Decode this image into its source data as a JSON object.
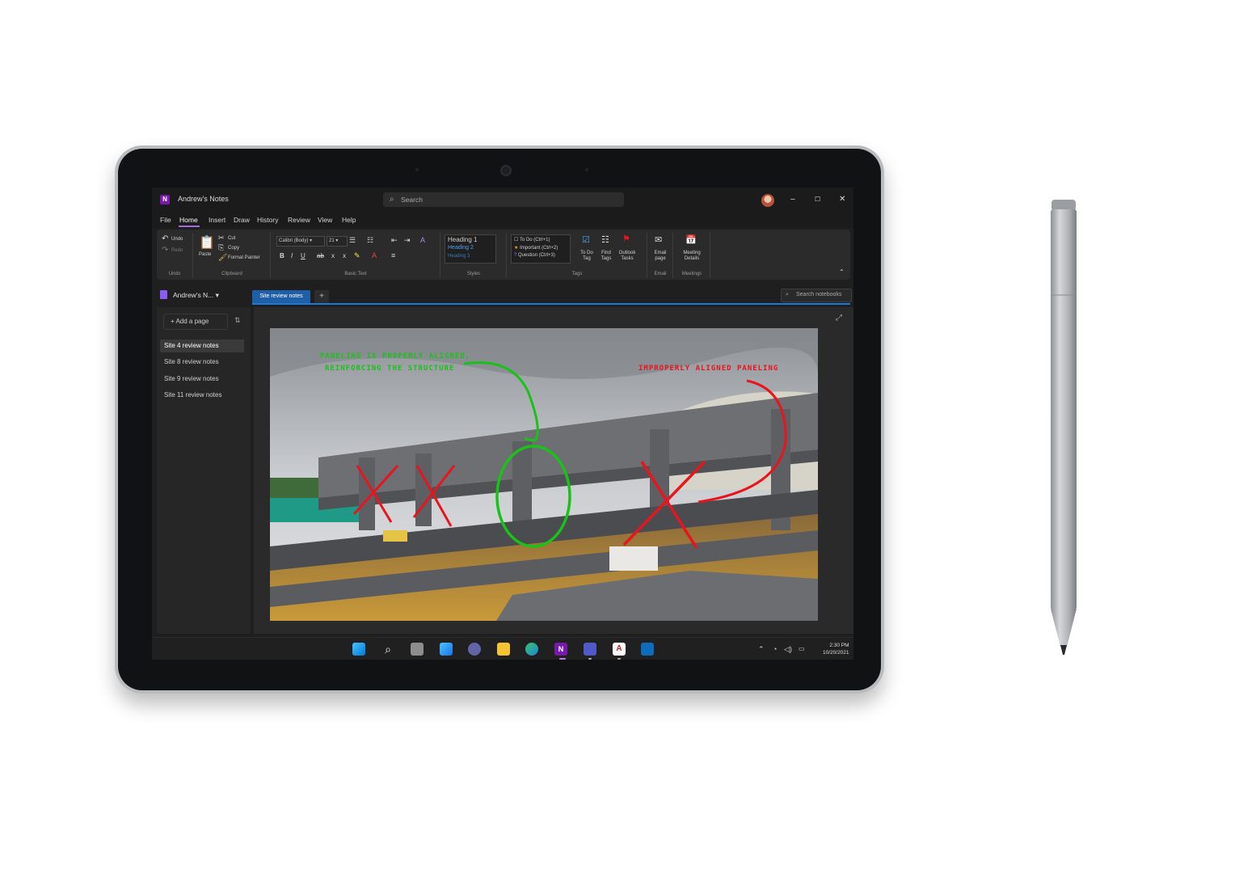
{
  "window": {
    "app_title": "Andrew's Notes",
    "search_placeholder": "Search"
  },
  "menu": [
    "File",
    "Home",
    "Insert",
    "Draw",
    "History",
    "Review",
    "View",
    "Help"
  ],
  "ribbon": {
    "undo_label": "Undo",
    "redo_label": "Redo",
    "undo_group": "Undo",
    "paste_label": "Paste",
    "cut_label": "Cut",
    "copy_label": "Copy",
    "format_painter_label": "Format Painter",
    "clipboard_group": "Clipboard",
    "font_name": "Calibri (Body)",
    "font_size": "21",
    "basic_text_group": "Basic Text",
    "styles": [
      "Heading 1",
      "Heading 2",
      "Heading 3"
    ],
    "styles_group": "Styles",
    "tags": [
      "To Do (Ctrl+1)",
      "Important (Ctrl+2)",
      "Question (Ctrl+3)"
    ],
    "todo_tag_label": "To Do Tag",
    "find_tags_label": "Find Tags",
    "outlook_tasks_label": "Outlook Tasks",
    "tags_group": "Tags",
    "email_page_label": "Email page",
    "email_group": "Email",
    "meeting_details_label": "Meeting Details",
    "meetings_group": "Meetings"
  },
  "notebook": {
    "name": "Andrew's N...",
    "section_tab": "Site review notes",
    "search_notebooks": "Search notebooks"
  },
  "pages": {
    "add_page_label": "Add a page",
    "items": [
      "Site 4 review notes",
      "Site 8 review notes",
      "Site 9 review notes",
      "Site 11 review notes"
    ],
    "selected_index": 0
  },
  "annotations": {
    "green_note_line1": "PANELING IS PROPERLY ALIGNED,",
    "green_note_line2": "REINFORCING THE STRUCTURE",
    "red_note": "IMPROPERLY ALIGNED PANELING",
    "green_color": "#19c219",
    "red_color": "#e8141e"
  },
  "taskbar": {
    "icons": [
      "windows-start",
      "search",
      "task-view",
      "widgets",
      "teams-chat",
      "file-explorer",
      "edge",
      "onenote",
      "teams",
      "acrobat",
      "outlook"
    ],
    "time": "2:30 PM",
    "date": "10/20/2021"
  },
  "colors": {
    "onenote_purple": "#7719aa",
    "section_tab_blue": "#1e5fa8",
    "dark_bg": "#1f1f1f"
  }
}
